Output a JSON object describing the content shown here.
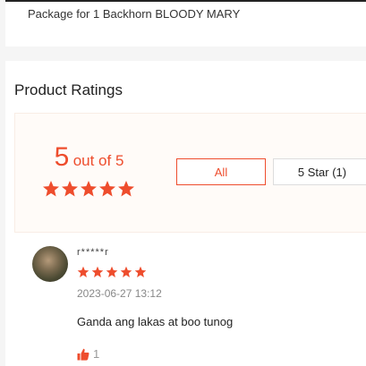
{
  "package": {
    "text": "Package for 1 Backhorn BLOODY MARY"
  },
  "ratings": {
    "title": "Product Ratings",
    "score": "5",
    "out_of": "out of 5",
    "stars": 5,
    "filters": {
      "all": "All",
      "five_star": "5 Star (1)"
    }
  },
  "review": {
    "username": "r*****r",
    "stars": 5,
    "date": "2023-06-27 13:12",
    "text": "Ganda ang lakas at boo tunog",
    "likes": "1"
  },
  "colors": {
    "accent": "#ee4d2d",
    "muted": "#888888"
  }
}
